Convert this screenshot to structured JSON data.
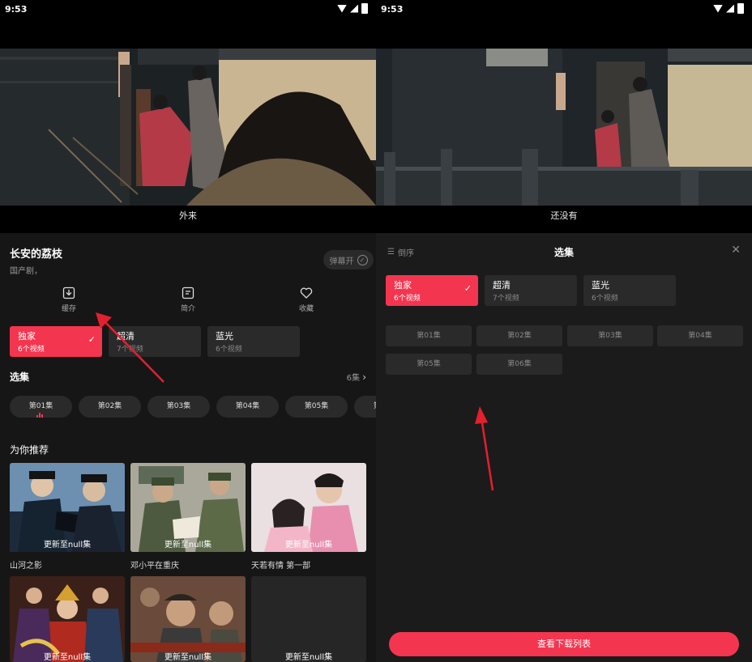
{
  "status_bar": {
    "time": "9:53"
  },
  "video": {
    "subtitle_left": "外来",
    "subtitle_right": "还没有"
  },
  "show": {
    "title": "长安的荔枝",
    "tag": "国产剧，"
  },
  "danmu": {
    "label": "弹幕开"
  },
  "actions": [
    {
      "label": "缓存",
      "icon": "download-icon"
    },
    {
      "label": "简介",
      "icon": "info-doc-icon"
    },
    {
      "label": "收藏",
      "icon": "heart-icon"
    }
  ],
  "qualities": [
    {
      "label": "独家",
      "sub": "6个视频",
      "active": true
    },
    {
      "label": "超清",
      "sub": "7个视频",
      "active": false
    },
    {
      "label": "蓝光",
      "sub": "6个视频",
      "active": false
    }
  ],
  "episodes_section": {
    "title": "选集",
    "count": "6集"
  },
  "episodes": [
    "第01集",
    "第02集",
    "第03集",
    "第04集",
    "第05集",
    "第06集"
  ],
  "recommend": {
    "title": "为你推荐",
    "items": [
      {
        "name": "山河之影",
        "update": "更新至null集"
      },
      {
        "name": "邓小平在重庆",
        "update": "更新至null集"
      },
      {
        "name": "天若有情 第一部",
        "update": "更新至null集"
      },
      {
        "name": "",
        "update": "更新至null集"
      },
      {
        "name": "",
        "update": "更新至null集"
      },
      {
        "name": "",
        "update": "更新至null集"
      }
    ]
  },
  "episode_panel": {
    "title": "选集",
    "sort_label": "倒序",
    "download_list_button": "查看下载列表"
  },
  "colors": {
    "accent": "#f4354f",
    "background": "#161616",
    "card": "#2a2a2a"
  }
}
